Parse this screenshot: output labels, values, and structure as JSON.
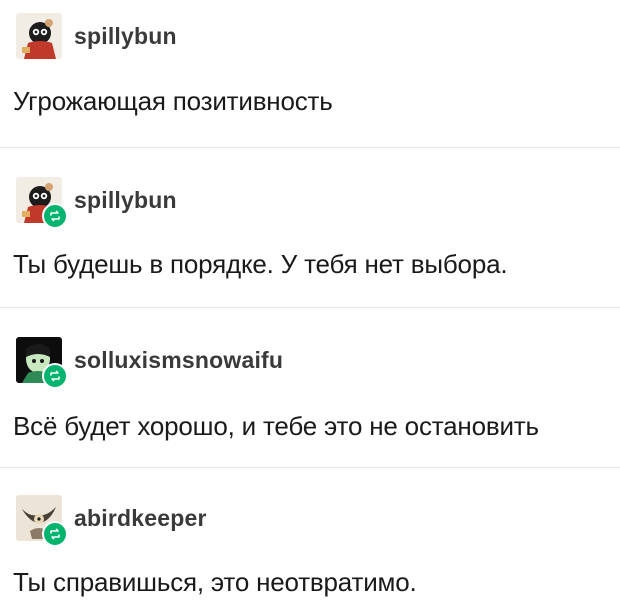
{
  "posts": [
    {
      "username": "spillybun",
      "text": "Угрожающая позитивность",
      "avatar_icon": "cartoon-character-avatar",
      "reblogged": false
    },
    {
      "username": "spillybun",
      "text": "Ты будешь в порядке. У тебя нет выбора.",
      "avatar_icon": "cartoon-character-avatar",
      "reblogged": true
    },
    {
      "username": "solluxismsnowaifu",
      "text": "Всё будет хорошо, и тебе это не остановить",
      "avatar_icon": "green-character-avatar",
      "reblogged": true
    },
    {
      "username": "abirdkeeper",
      "text": "Ты справишься, это неотвратимо.",
      "avatar_icon": "bird-avatar",
      "reblogged": true
    }
  ],
  "colors": {
    "reblog_badge": "#00b46e",
    "username": "#3a3a3a",
    "text": "#1a1a1a",
    "divider": "#e7e7e7"
  }
}
